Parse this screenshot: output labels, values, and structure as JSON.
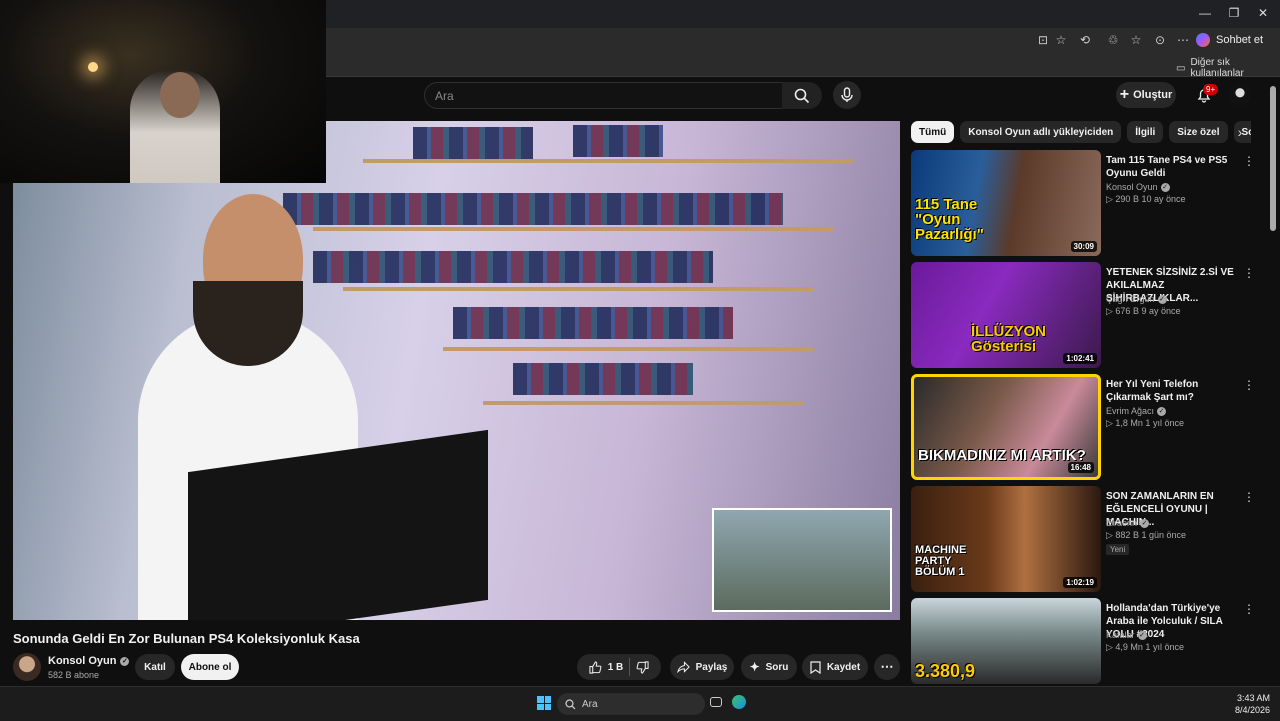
{
  "browser": {
    "window_controls": {
      "minimize": "—",
      "restore": "❐",
      "close": "✕"
    },
    "toolbar_icons": [
      "⊡",
      "☆",
      "⟲",
      "♲",
      "☆",
      "⊙",
      "⋯"
    ],
    "chat_button_label": "Sohbet et",
    "bookmark_other_label": "Diğer sık kullanılanlar"
  },
  "header": {
    "search_placeholder": "Ara",
    "create_label": "Oluştur",
    "notification_count": "9+"
  },
  "video": {
    "title": "Sonunda Geldi En Zor Bulunan PS4 Koleksiyonluk Kasa",
    "channel_name": "Konsol Oyun",
    "subscriber_count": "582 B abone",
    "join_label": "Katıl",
    "subscribe_label": "Abone ol",
    "like_count": "1 B",
    "share_label": "Paylaş",
    "ask_label": "Soru",
    "save_label": "Kaydet"
  },
  "chips": [
    "Tümü",
    "Konsol Oyun adlı yükleyiciden",
    "İlgili",
    "Size özel",
    "Son"
  ],
  "recommendations": [
    {
      "title": "Tam 115 Tane PS4 ve PS5 Oyunu Geldi",
      "channel": "Konsol Oyun",
      "verified": true,
      "meta": "▷ 290 B   10 ay önce",
      "duration": "30:09",
      "thumb_text": "115 Tane \"Oyun Pazarlığı\"",
      "badge": ""
    },
    {
      "title": "YETENEK SİZSİNİZ 2.Sİ VE AKILALMAZ SİHİRBAZLIKLAR...",
      "channel": "Çağrı Ergün",
      "verified": true,
      "meta": "▷ 676 B   9 ay önce",
      "duration": "1:02:41",
      "thumb_text": "İLLÜZYON Gösterisi",
      "badge": ""
    },
    {
      "title": "Her Yıl Yeni Telefon Çıkarmak Şart mı?",
      "channel": "Evrim Ağacı",
      "verified": true,
      "meta": "▷ 1,8 Mn   1 yıl önce",
      "duration": "16:48",
      "thumb_text": "BIKMADINIZ MI ARTIK?",
      "badge": ""
    },
    {
      "title": "SON ZAMANLARIN EN EĞLENCELİ OYUNU | MACHIN...",
      "channel": "Elraenn",
      "verified": true,
      "meta": "▷ 882 B   1 gün önce",
      "duration": "1:02:19",
      "thumb_text": "MACHINE PARTY BÖLÜM 1",
      "badge": "Yeni"
    },
    {
      "title": "Hollanda'dan Türkiye'ye Araba ile Yolculuk / SILA YOLU #2024",
      "channel": "Kafalar",
      "verified": true,
      "meta": "▷ 4,9 Mn   1 yıl önce",
      "duration": "",
      "thumb_text": "3.380,9",
      "badge": ""
    }
  ],
  "taskbar": {
    "search_placeholder": "Ara",
    "time": "3:43 AM",
    "date": "8/4/2026"
  },
  "colors": {
    "background": "#0f0f0f",
    "accent_red": "#cc0000",
    "chip_active": "#f1f1f1",
    "windows_blue": "#4cc2ff"
  }
}
